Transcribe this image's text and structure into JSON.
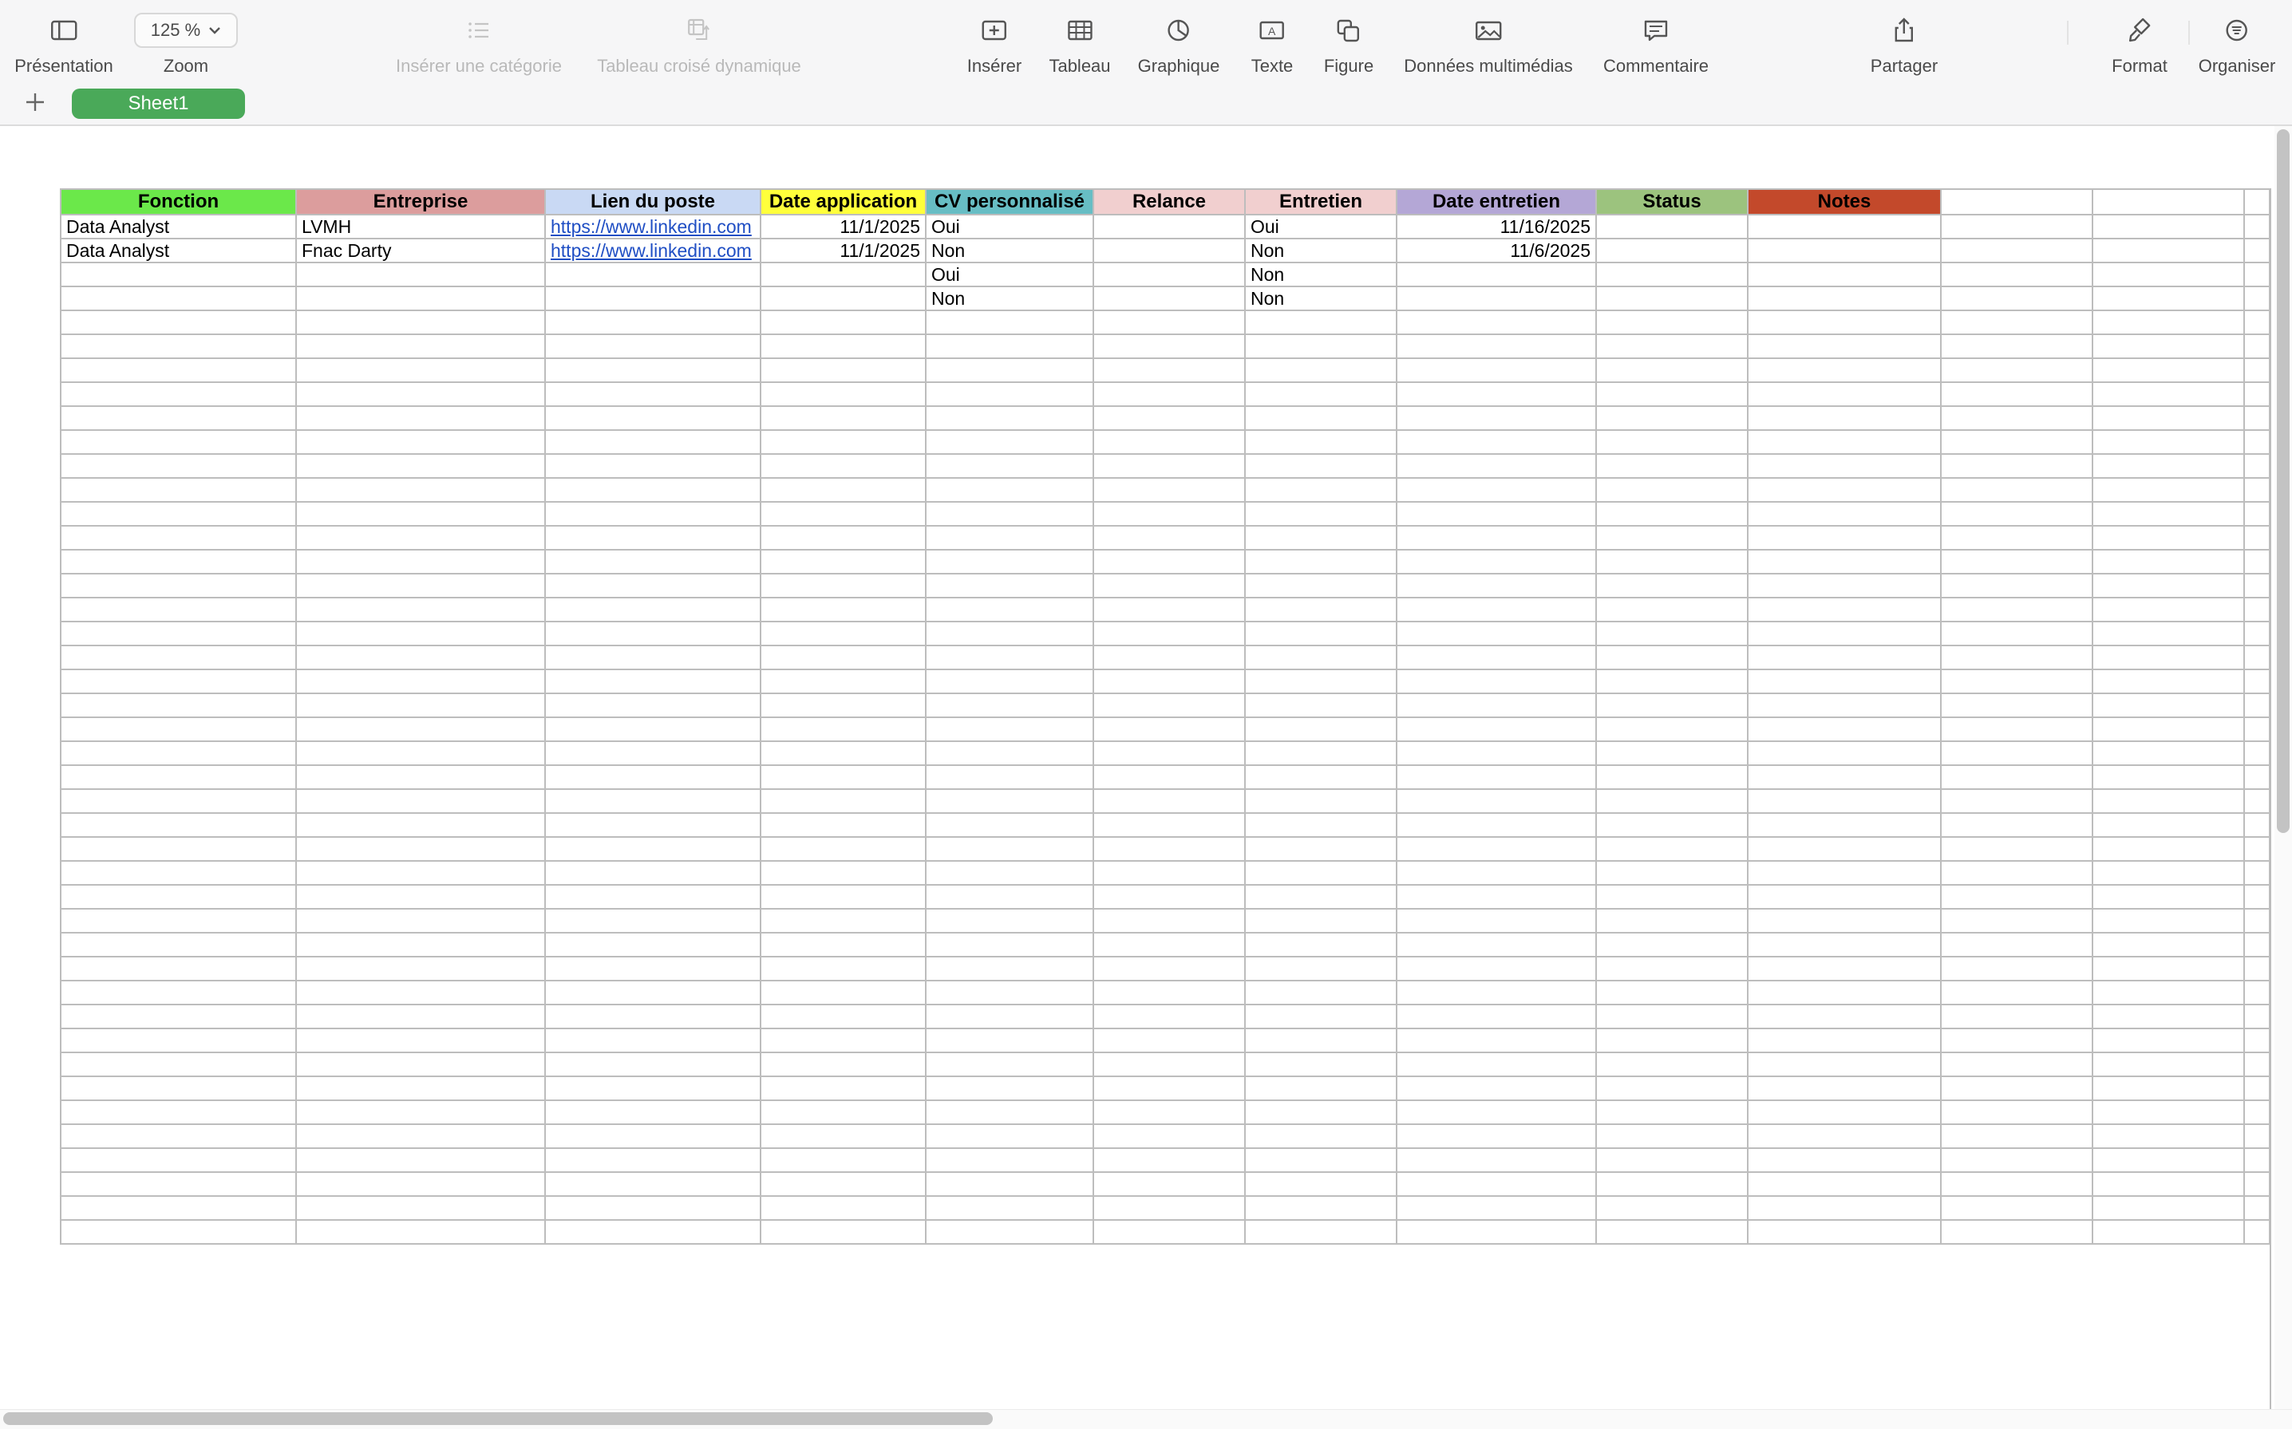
{
  "toolbar": {
    "presentation": "Présentation",
    "zoom_value": "125 %",
    "zoom_label": "Zoom",
    "insert_category": "Insérer une catégorie",
    "pivot_table": "Tableau croisé dynamique",
    "insert": "Insérer",
    "table": "Tableau",
    "chart": "Graphique",
    "text": "Texte",
    "shape": "Figure",
    "media": "Données multimédias",
    "comment": "Commentaire",
    "share": "Partager",
    "format": "Format",
    "organize": "Organiser"
  },
  "sheets": {
    "active_tab": "Sheet1"
  },
  "table": {
    "headers": [
      "Fonction",
      "Entreprise",
      "Lien du poste",
      "Date application",
      "CV personnalisé",
      "Relance",
      "Entretien",
      "Date entretien",
      "Status",
      "Notes"
    ],
    "header_colors": [
      "#6be84a",
      "#dc9d9d",
      "#c9d9f4",
      "#ffff3b",
      "#67bdc4",
      "#f1cfcf",
      "#f1cfcf",
      "#b4a7d6",
      "#9cc37e",
      "#c3492b"
    ],
    "rows": [
      [
        "Data Analyst",
        "LVMH",
        "https://www.linkedin.com",
        "11/1/2025",
        "Oui",
        "",
        "Oui",
        "11/16/2025",
        "",
        ""
      ],
      [
        "Data Analyst",
        "Fnac Darty",
        "https://www.linkedin.com",
        "11/1/2025",
        "Non",
        "",
        "Non",
        "11/6/2025",
        "",
        ""
      ],
      [
        "",
        "",
        "",
        "",
        "Oui",
        "",
        "Non",
        "",
        "",
        ""
      ],
      [
        "",
        "",
        "",
        "",
        "Non",
        "",
        "Non",
        "",
        "",
        ""
      ]
    ]
  }
}
